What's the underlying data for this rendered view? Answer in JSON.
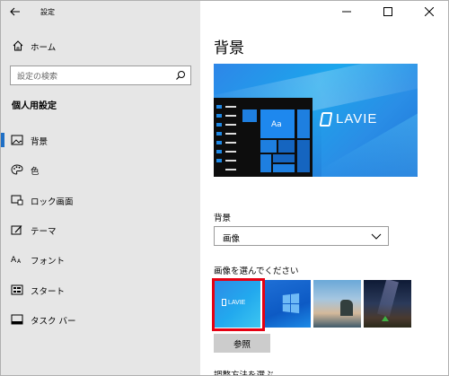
{
  "window": {
    "title": "設定"
  },
  "sidebar": {
    "home_label": "ホーム",
    "search_placeholder": "設定の検索",
    "section_title": "個人用設定",
    "items": [
      {
        "label": "背景",
        "icon": "picture-icon",
        "active": true
      },
      {
        "label": "色",
        "icon": "palette-icon",
        "active": false
      },
      {
        "label": "ロック画面",
        "icon": "lock-screen-icon",
        "active": false
      },
      {
        "label": "テーマ",
        "icon": "theme-icon",
        "active": false
      },
      {
        "label": "フォント",
        "icon": "font-icon",
        "active": false
      },
      {
        "label": "スタート",
        "icon": "start-icon",
        "active": false
      },
      {
        "label": "タスク バー",
        "icon": "taskbar-icon",
        "active": false
      }
    ]
  },
  "main": {
    "page_title": "背景",
    "preview": {
      "tile_text": "Aa",
      "logo_text": "LAVIE"
    },
    "background_label": "背景",
    "background_select_value": "画像",
    "choose_label": "画像を選んでください",
    "thumbnails": [
      {
        "name": "LAVIE",
        "selected": true
      },
      {
        "name": "windows",
        "selected": false
      },
      {
        "name": "beach",
        "selected": false
      },
      {
        "name": "night-sky",
        "selected": false
      }
    ],
    "browse_label": "参照",
    "fit_label": "調整方法を選ぶ"
  },
  "colors": {
    "accent": "#1f6fc5",
    "selection": "#e60012",
    "sidebar_bg": "#e6e6e6"
  }
}
